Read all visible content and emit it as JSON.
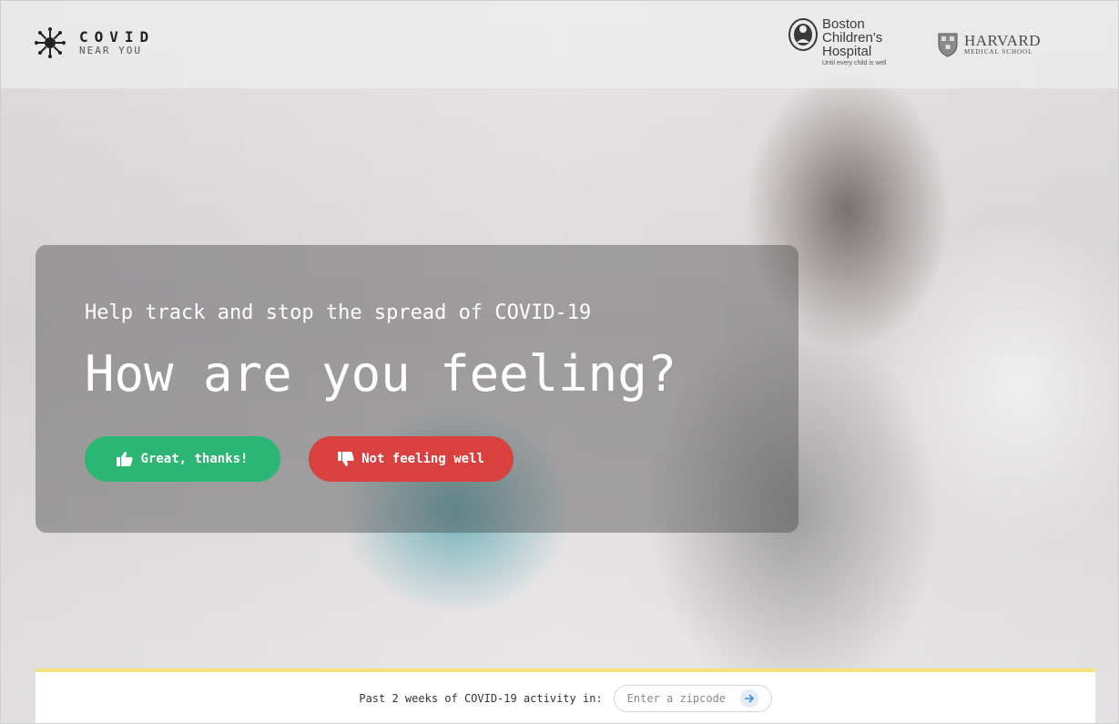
{
  "header": {
    "logo": {
      "title": "COVID",
      "subtitle": "NEAR YOU",
      "icon": "virus-molecule-icon"
    },
    "partners": [
      {
        "name_lines": [
          "Boston",
          "Children's",
          "Hospital"
        ],
        "tagline": "Until every child is well",
        "icon": "bch-crest-icon"
      },
      {
        "name": "HARVARD",
        "subtitle": "MEDICAL SCHOOL",
        "icon": "harvard-shield-icon"
      }
    ]
  },
  "hero": {
    "tagline": "Help track and stop the spread of COVID-19",
    "headline": "How are you feeling?",
    "buttons": {
      "good": {
        "label": "Great, thanks!",
        "icon": "thumbs-up-icon",
        "color": "#2bb673"
      },
      "bad": {
        "label": "Not feeling well",
        "icon": "thumbs-down-icon",
        "color": "#d9413f"
      }
    }
  },
  "activity": {
    "label": "Past 2 weeks of COVID-19 activity in:",
    "zip_placeholder": "Enter a zipcode",
    "submit_icon": "arrow-right-icon",
    "accent": "#f3e27a"
  }
}
